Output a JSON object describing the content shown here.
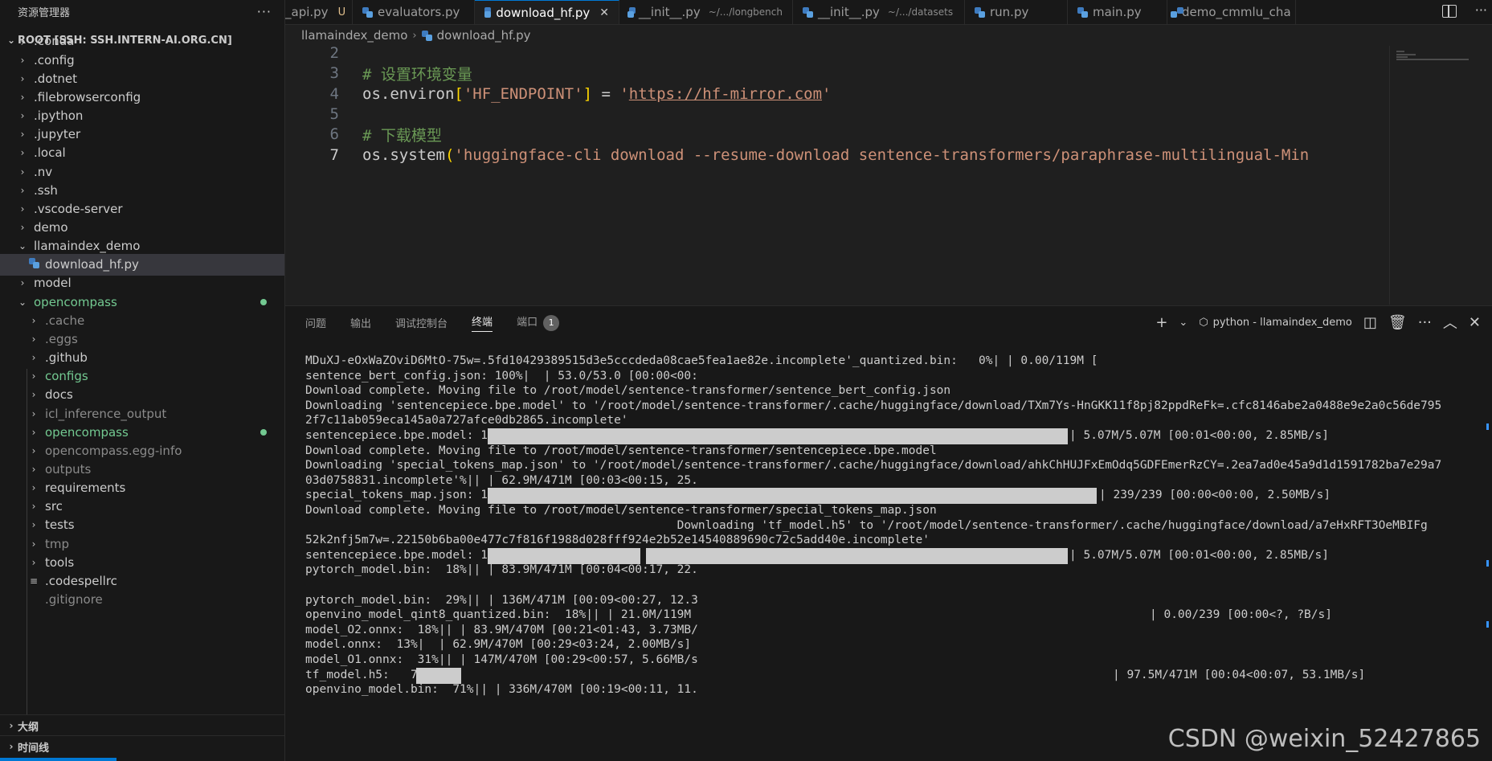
{
  "explorer": {
    "title": "资源管理器",
    "more": "···",
    "root": "ROOT [SSH: SSH.INTERN-AI.ORG.CN]",
    "items": [
      {
        "label": ".conda",
        "chev": "›",
        "level": 1,
        "style": "partial"
      },
      {
        "label": ".config",
        "chev": "›",
        "level": 1
      },
      {
        "label": ".dotnet",
        "chev": "›",
        "level": 1
      },
      {
        "label": ".filebrowserconfig",
        "chev": "›",
        "level": 1
      },
      {
        "label": ".ipython",
        "chev": "›",
        "level": 1
      },
      {
        "label": ".jupyter",
        "chev": "›",
        "level": 1
      },
      {
        "label": ".local",
        "chev": "›",
        "level": 1
      },
      {
        "label": ".nv",
        "chev": "›",
        "level": 1
      },
      {
        "label": ".ssh",
        "chev": "›",
        "level": 1
      },
      {
        "label": ".vscode-server",
        "chev": "›",
        "level": 1
      },
      {
        "label": "demo",
        "chev": "›",
        "level": 1
      },
      {
        "label": "llamaindex_demo",
        "chev": "⌄",
        "level": 1
      },
      {
        "label": "download_hf.py",
        "chev": "",
        "level": 2,
        "style": "selected",
        "icon": "python"
      },
      {
        "label": "model",
        "chev": "›",
        "level": 1
      },
      {
        "label": "opencompass",
        "chev": "⌄",
        "level": 1,
        "style": "green"
      },
      {
        "label": ".cache",
        "chev": "›",
        "level": 2,
        "style": "dim"
      },
      {
        "label": ".eggs",
        "chev": "›",
        "level": 2,
        "style": "dim"
      },
      {
        "label": ".github",
        "chev": "›",
        "level": 2
      },
      {
        "label": "configs",
        "chev": "›",
        "level": 2,
        "style": "green"
      },
      {
        "label": "docs",
        "chev": "›",
        "level": 2
      },
      {
        "label": "icl_inference_output",
        "chev": "›",
        "level": 2,
        "style": "dim"
      },
      {
        "label": "opencompass",
        "chev": "›",
        "level": 2,
        "style": "green"
      },
      {
        "label": "opencompass.egg-info",
        "chev": "›",
        "level": 2,
        "style": "dim"
      },
      {
        "label": "outputs",
        "chev": "›",
        "level": 2,
        "style": "dim"
      },
      {
        "label": "requirements",
        "chev": "›",
        "level": 2
      },
      {
        "label": "src",
        "chev": "›",
        "level": 2
      },
      {
        "label": "tests",
        "chev": "›",
        "level": 2
      },
      {
        "label": "tmp",
        "chev": "›",
        "level": 2,
        "style": "dim"
      },
      {
        "label": "tools",
        "chev": "›",
        "level": 2
      },
      {
        "label": ".codespellrc",
        "chev": "",
        "level": 2,
        "icon": "lines"
      },
      {
        "label": ".gitignore",
        "chev": "",
        "level": 2,
        "style": "dim"
      }
    ],
    "outline": "大纲",
    "timeline": "时间线"
  },
  "tabs": [
    {
      "label": "_api.py",
      "mod": "U"
    },
    {
      "label": "evaluators.py"
    },
    {
      "label": "download_hf.py",
      "active": true
    },
    {
      "label": "__init__.py",
      "path": "~/.../longbench"
    },
    {
      "label": "__init__.py",
      "path": "~/.../datasets"
    },
    {
      "label": "run.py"
    },
    {
      "label": "main.py"
    },
    {
      "label": "demo_cmmlu_cha"
    }
  ],
  "tab_close": "✕",
  "tabs_more": "···",
  "breadcrumb": [
    "llamaindex_demo",
    "download_hf.py"
  ],
  "editor": {
    "lines": [
      {
        "num": "2"
      },
      {
        "num": "3",
        "comment": "# 设置环境变量"
      },
      {
        "num": "4",
        "code_a": "os.environ",
        "brk_open": "[",
        "str1": "'HF_ENDPOINT'",
        "brk_close": "]",
        "eq": " = ",
        "q1": "'",
        "url": "https://hf-mirror.com",
        "q2": "'"
      },
      {
        "num": "5"
      },
      {
        "num": "6",
        "comment": "# 下载模型"
      },
      {
        "num": "7",
        "code_a": "os.system",
        "brk_open": "(",
        "str1": "'huggingface-cli download --resume-download sentence-transformers/paraphrase-multilingual-Min",
        "current": true
      }
    ]
  },
  "panel": {
    "tabs": [
      "问题",
      "输出",
      "调试控制台",
      "终端",
      "端口"
    ],
    "active_tab": "终端",
    "ports_badge": "1",
    "plus": "+",
    "chevron": "⌄",
    "shell": "python - llamaindex_demo",
    "icons": {
      "split": "◫",
      "trash": "🗑",
      "more": "···",
      "maximize": "︿",
      "close": "✕"
    }
  },
  "terminal": [
    "MDuXJ-eOxWaZOviD6MtO-75w=.5fd10429389515d3e5cccdeda08cae5fea1ae82e.incomplete'_quantized.bin:   0%| | 0.00/119M [",
    "sentence_bert_config.json: 100%|  | 53.0/53.0 [00:00<00:",
    "Download complete. Moving file to /root/model/sentence-transformer/sentence_bert_config.json",
    "Downloading 'sentencepiece.bpe.model' to '/root/model/sentence-transformer/.cache/huggingface/download/TXm7Ys-HnGKK11f8pj82ppdReFk=.cfc8146abe2a0488e9e2a0c56de795",
    "2f7c11ab059eca145a0a727afce0db2865.incomplete'",
    "sentencepiece.bpe.model: 100%|",
    "Download complete. Moving file to /root/model/sentence-transformer/sentencepiece.bpe.model",
    "Downloading 'special_tokens_map.json' to '/root/model/sentence-transformer/.cache/huggingface/download/ahkChHUJFxEmOdq5GDFEmerRzCY=.2ea7ad0e45a9d1d1591782ba7e29a7",
    "03d0758831.incomplete'%|| | 62.9M/471M [00:03<00:15, 25.",
    "special_tokens_map.json: 100%|",
    "Download complete. Moving file to /root/model/sentence-transformer/special_tokens_map.json",
    "                                                     Downloading 'tf_model.h5' to '/root/model/sentence-transformer/.cache/huggingface/download/a7eHxRFT3OeMBIFg",
    "52k2nfj5m7w=.22150b6ba00e477c7f816f1988d028fff924e2b52e14540889690c72c5add40e.incomplete'",
    "sentencepiece.bpe.model: 100%|",
    "pytorch_model.bin:  18%|| | 83.9M/471M [00:04<00:17, 22.",
    "",
    "pytorch_model.bin:  29%|| | 136M/471M [00:09<00:27, 12.3",
    "openvino_model_qint8_quantized.bin:  18%|| | 21.0M/119M",
    "model_O2.onnx:  18%|| | 83.9M/470M [00:21<01:43, 3.73MB/",
    "model.onnx:  13%|  | 62.9M/470M [00:29<03:24, 2.00MB/s]",
    "model_O1.onnx:  31%|| | 147M/470M [00:29<00:57, 5.66MB/s",
    "tf_model.h5:   7%|",
    "openvino_model.bin:  71%|| | 336M/470M [00:19<00:11, 11."
  ],
  "terminal_right": {
    "l5": "| 5.07M/5.07M [00:01<00:00, 2.85MB/s]",
    "l9": "| 239/239 [00:00<00:00, 2.50MB/s]",
    "l13": "| 5.07M/5.07M [00:01<00:00, 2.85MB/s]",
    "l17": "| 0.00/239 [00:00<?, ?B/s]",
    "l21": "| 97.5M/471M [00:04<00:07, 53.1MB/s]"
  },
  "progress": {
    "sentencepiece_bpe_1": 1.0,
    "special_tokens_map": 1.0,
    "sentencepiece_bpe_2": 1.0,
    "tf_model_h5": 0.07
  },
  "watermark": "CSDN @weixin_52427865"
}
